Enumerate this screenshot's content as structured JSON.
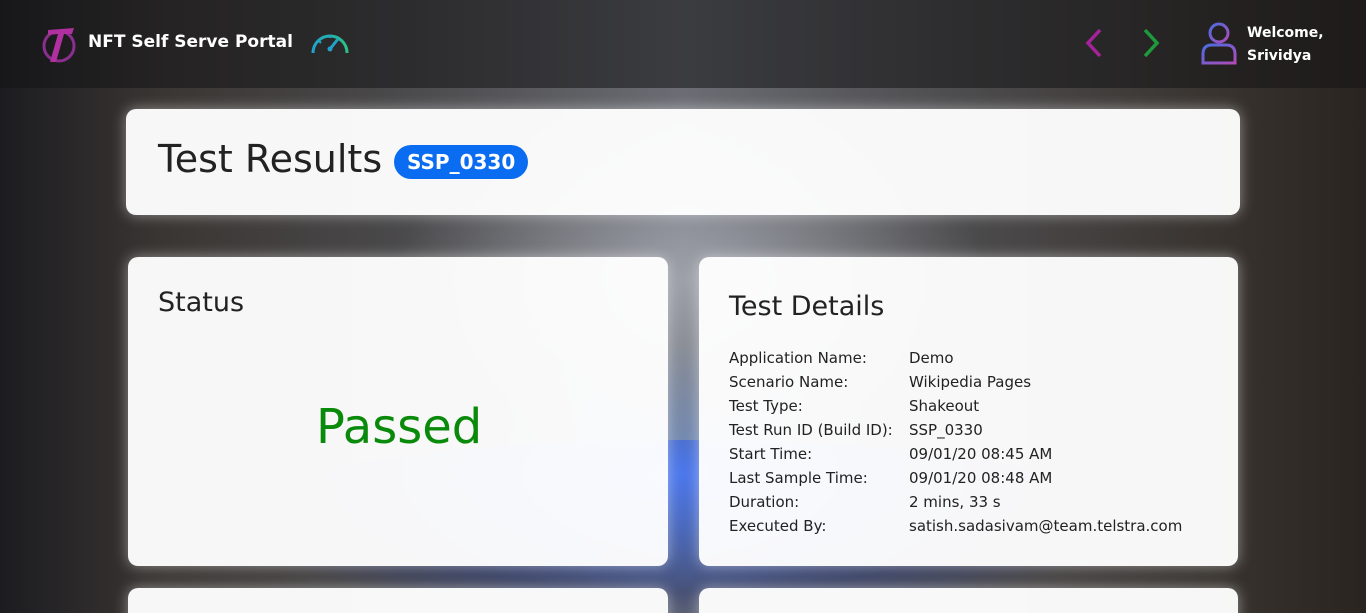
{
  "header": {
    "portal_title": "NFT Self Serve Portal",
    "welcome_line1": "Welcome,",
    "welcome_line2": "Srividya"
  },
  "page": {
    "title": "Test Results",
    "run_badge": "SSP_0330"
  },
  "status_card": {
    "title": "Status",
    "value": "Passed"
  },
  "details_card": {
    "title": "Test Details",
    "rows": [
      {
        "label": "Application Name:",
        "value": "Demo"
      },
      {
        "label": "Scenario Name:",
        "value": "Wikipedia Pages"
      },
      {
        "label": "Test Type:",
        "value": "Shakeout"
      },
      {
        "label": "Test Run ID (Build ID):",
        "value": "SSP_0330"
      },
      {
        "label": "Start Time:",
        "value": "09/01/20 08:45 AM"
      },
      {
        "label": "Last Sample Time:",
        "value": "09/01/20 08:48 AM"
      },
      {
        "label": "Duration:",
        "value": "2 mins, 33 s"
      },
      {
        "label": "Executed By:",
        "value": "satish.sadasivam@team.telstra.com"
      }
    ]
  },
  "colors": {
    "brand_magenta": "#a4239b",
    "badge_blue": "#0a6cf0",
    "passed_green": "#0a8a0a",
    "back_arrow": "#a4239b",
    "forward_arrow": "#1e9a3c"
  },
  "icons": {
    "logo": "telstra-logo-icon",
    "dashboard": "speedometer-icon",
    "back": "chevron-left-icon",
    "forward": "chevron-right-icon",
    "user": "user-icon"
  }
}
